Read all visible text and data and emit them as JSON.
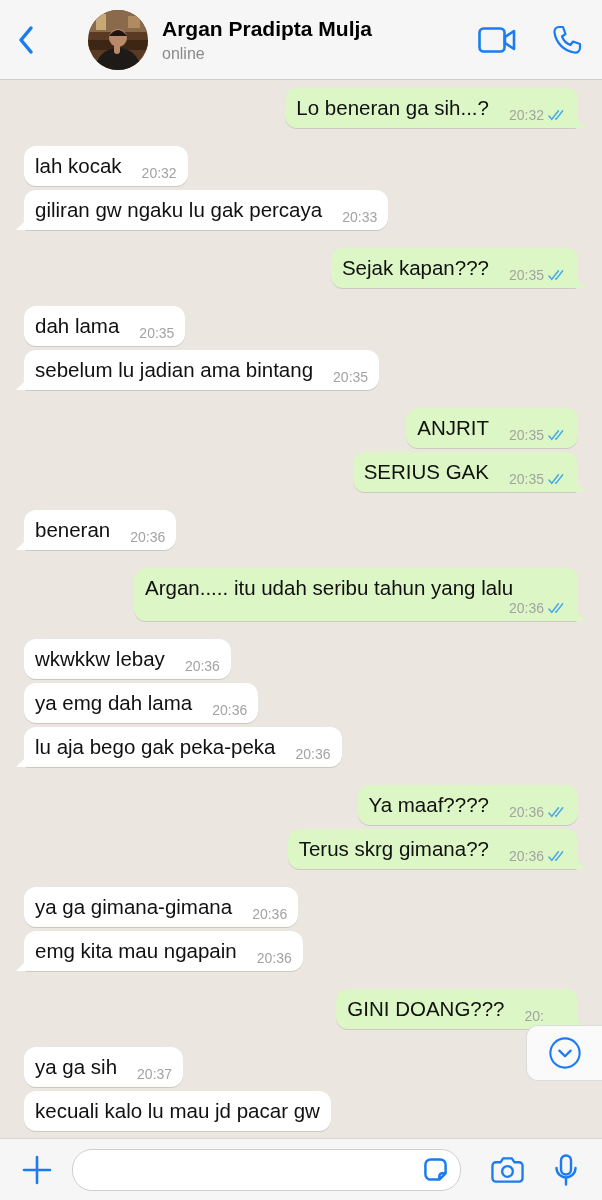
{
  "header": {
    "contact_name": "Argan Pradipta Mulja",
    "status": "online"
  },
  "messages": [
    {
      "kind": "out",
      "text": "Lo beneran ga sih...?",
      "time": "20:32",
      "read": true,
      "tail": true
    },
    {
      "kind": "in",
      "text": "lah kocak",
      "time": "20:32",
      "tail": false
    },
    {
      "kind": "in",
      "text": "giliran gw ngaku lu gak percaya",
      "time": "20:33",
      "tail": true
    },
    {
      "kind": "out",
      "text": "Sejak kapan???",
      "time": "20:35",
      "read": true,
      "tail": true
    },
    {
      "kind": "in",
      "text": "dah lama",
      "time": "20:35",
      "tail": false
    },
    {
      "kind": "in",
      "text": "sebelum lu jadian ama bintang",
      "time": "20:35",
      "tail": true
    },
    {
      "kind": "out",
      "text": "ANJRIT",
      "time": "20:35",
      "read": true,
      "tail": false
    },
    {
      "kind": "out",
      "text": "SERIUS GAK",
      "time": "20:35",
      "read": true,
      "tail": true
    },
    {
      "kind": "in",
      "text": "beneran",
      "time": "20:36",
      "tail": true
    },
    {
      "kind": "out",
      "text": "Argan..... itu udah seribu tahun yang lalu",
      "time": "20:36",
      "read": true,
      "tail": true
    },
    {
      "kind": "in",
      "text": "wkwkkw lebay",
      "time": "20:36",
      "tail": false
    },
    {
      "kind": "in",
      "text": "ya emg dah lama",
      "time": "20:36",
      "tail": false
    },
    {
      "kind": "in",
      "text": "lu aja bego gak peka-peka",
      "time": "20:36",
      "tail": true
    },
    {
      "kind": "out",
      "text": "Ya maaf????",
      "time": "20:36",
      "read": true,
      "tail": false
    },
    {
      "kind": "out",
      "text": "Terus skrg gimana??",
      "time": "20:36",
      "read": true,
      "tail": true
    },
    {
      "kind": "in",
      "text": "ya ga gimana-gimana",
      "time": "20:36",
      "tail": false
    },
    {
      "kind": "in",
      "text": "emg kita mau ngapain",
      "time": "20:36",
      "tail": true
    },
    {
      "kind": "out",
      "text": "GINI DOANG???",
      "time": "20:",
      "read": false,
      "tail": true
    },
    {
      "kind": "in",
      "text": "ya ga sih",
      "time": "20:37",
      "tail": false
    },
    {
      "kind": "in",
      "text": "kecuali kalo lu mau jd pacar gw",
      "tail": false
    }
  ]
}
